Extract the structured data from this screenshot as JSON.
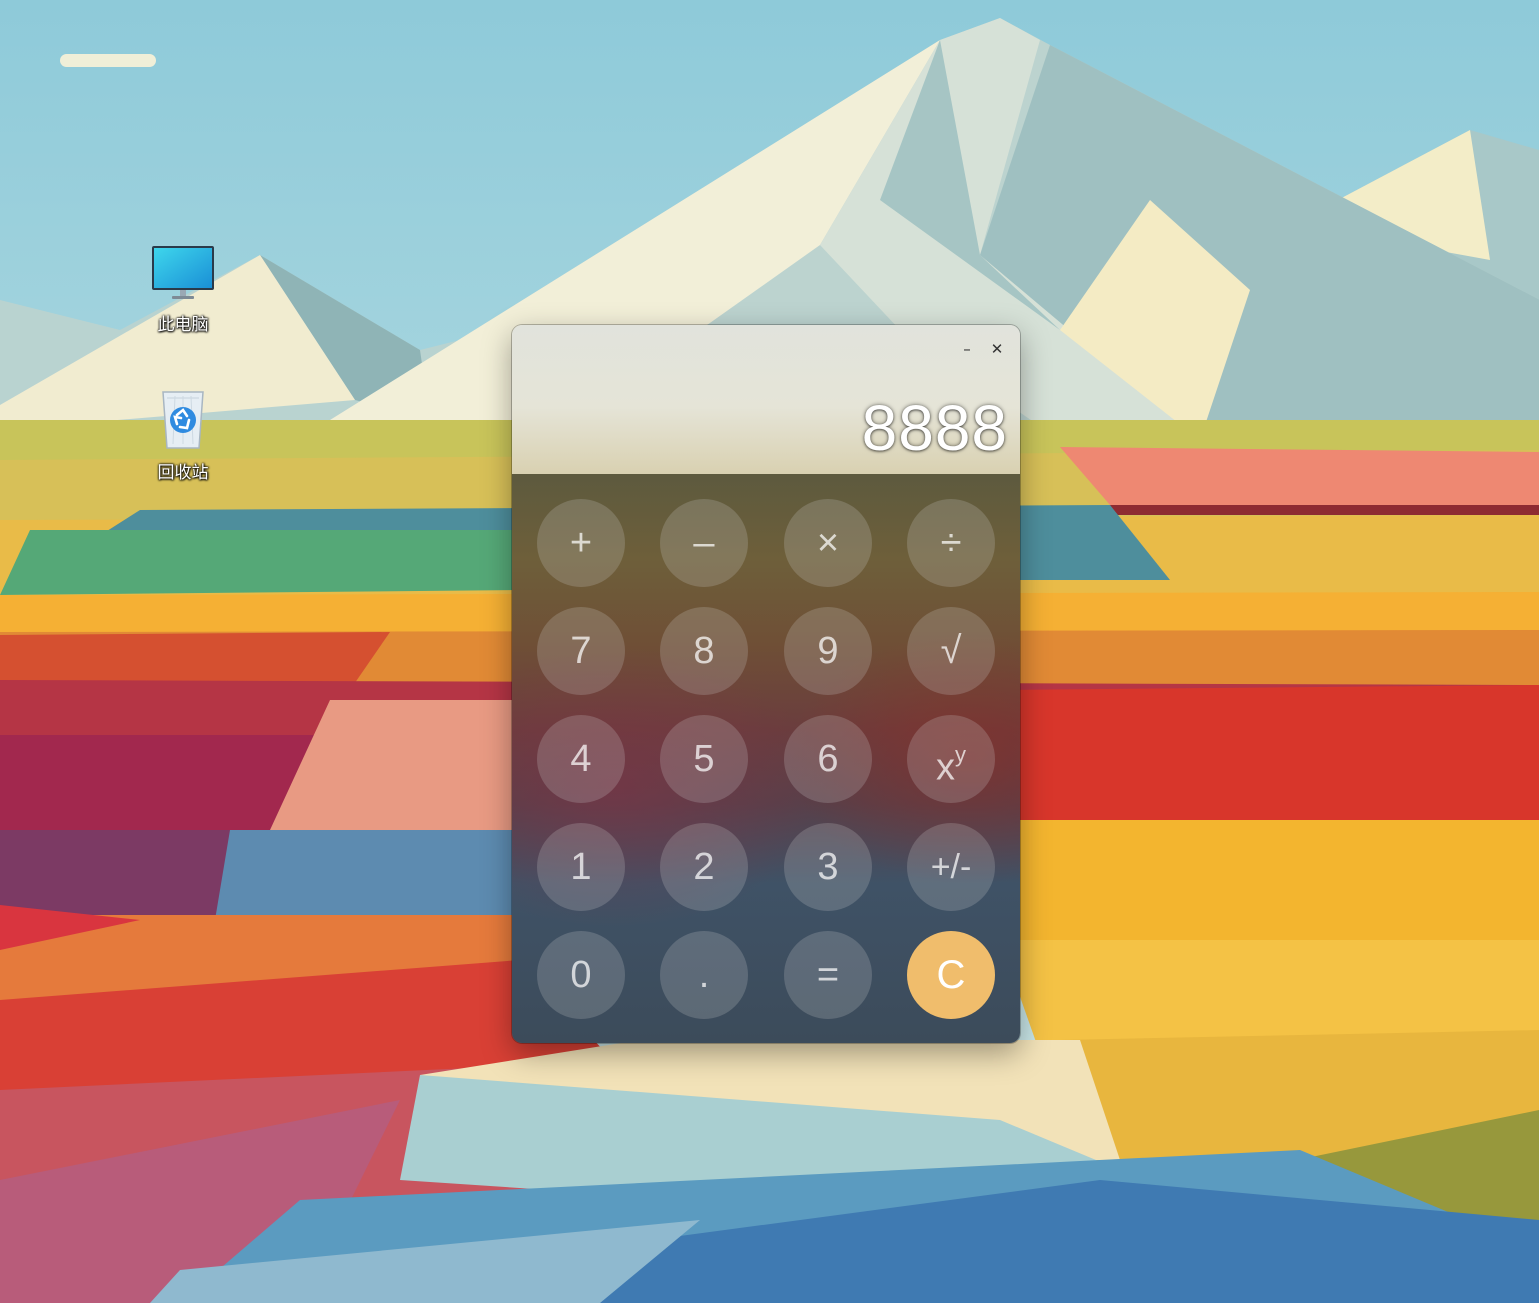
{
  "desktop": {
    "icons": [
      {
        "label": "此电脑",
        "icon": "monitor-icon"
      },
      {
        "label": "回收站",
        "icon": "recycle-bin-icon"
      }
    ]
  },
  "calculator": {
    "window_controls": {
      "minimize": "–",
      "close": "✕"
    },
    "display": "8888",
    "keys": {
      "plus": "+",
      "minus": "–",
      "multiply": "×",
      "divide": "÷",
      "seven": "7",
      "eight": "8",
      "nine": "9",
      "sqrt": "√",
      "four": "4",
      "five": "5",
      "six": "6",
      "power_base": "x",
      "power_exp": "y",
      "one": "1",
      "two": "2",
      "three": "3",
      "negate": "+/-",
      "zero": "0",
      "dot": ".",
      "equals": "=",
      "clear": "C"
    },
    "colors": {
      "clear_key": "#f0bd6c",
      "key_text": "#ffffff"
    }
  }
}
